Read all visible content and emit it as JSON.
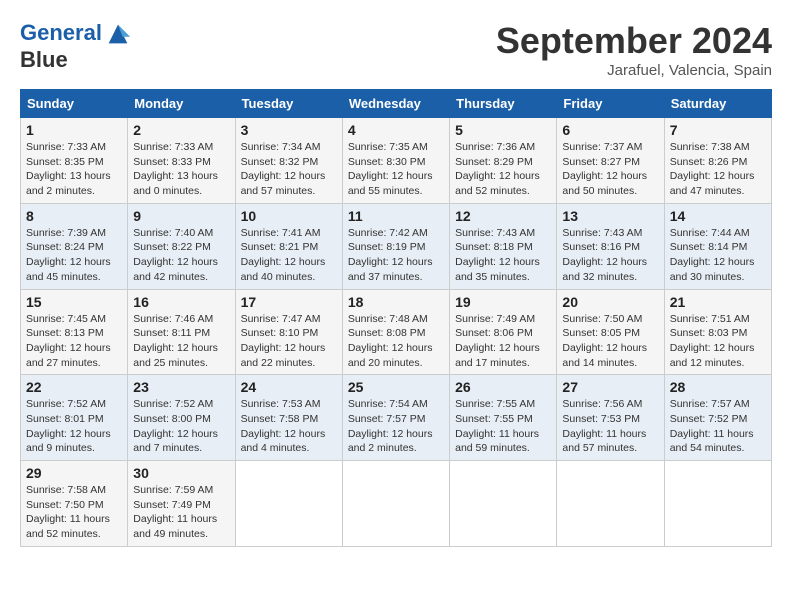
{
  "logo": {
    "line1": "General",
    "line2": "Blue"
  },
  "title": "September 2024",
  "location": "Jarafuel, Valencia, Spain",
  "days_of_week": [
    "Sunday",
    "Monday",
    "Tuesday",
    "Wednesday",
    "Thursday",
    "Friday",
    "Saturday"
  ],
  "weeks": [
    [
      {
        "day": "1",
        "sunrise": "Sunrise: 7:33 AM",
        "sunset": "Sunset: 8:35 PM",
        "daylight": "Daylight: 13 hours and 2 minutes."
      },
      {
        "day": "2",
        "sunrise": "Sunrise: 7:33 AM",
        "sunset": "Sunset: 8:33 PM",
        "daylight": "Daylight: 13 hours and 0 minutes."
      },
      {
        "day": "3",
        "sunrise": "Sunrise: 7:34 AM",
        "sunset": "Sunset: 8:32 PM",
        "daylight": "Daylight: 12 hours and 57 minutes."
      },
      {
        "day": "4",
        "sunrise": "Sunrise: 7:35 AM",
        "sunset": "Sunset: 8:30 PM",
        "daylight": "Daylight: 12 hours and 55 minutes."
      },
      {
        "day": "5",
        "sunrise": "Sunrise: 7:36 AM",
        "sunset": "Sunset: 8:29 PM",
        "daylight": "Daylight: 12 hours and 52 minutes."
      },
      {
        "day": "6",
        "sunrise": "Sunrise: 7:37 AM",
        "sunset": "Sunset: 8:27 PM",
        "daylight": "Daylight: 12 hours and 50 minutes."
      },
      {
        "day": "7",
        "sunrise": "Sunrise: 7:38 AM",
        "sunset": "Sunset: 8:26 PM",
        "daylight": "Daylight: 12 hours and 47 minutes."
      }
    ],
    [
      {
        "day": "8",
        "sunrise": "Sunrise: 7:39 AM",
        "sunset": "Sunset: 8:24 PM",
        "daylight": "Daylight: 12 hours and 45 minutes."
      },
      {
        "day": "9",
        "sunrise": "Sunrise: 7:40 AM",
        "sunset": "Sunset: 8:22 PM",
        "daylight": "Daylight: 12 hours and 42 minutes."
      },
      {
        "day": "10",
        "sunrise": "Sunrise: 7:41 AM",
        "sunset": "Sunset: 8:21 PM",
        "daylight": "Daylight: 12 hours and 40 minutes."
      },
      {
        "day": "11",
        "sunrise": "Sunrise: 7:42 AM",
        "sunset": "Sunset: 8:19 PM",
        "daylight": "Daylight: 12 hours and 37 minutes."
      },
      {
        "day": "12",
        "sunrise": "Sunrise: 7:43 AM",
        "sunset": "Sunset: 8:18 PM",
        "daylight": "Daylight: 12 hours and 35 minutes."
      },
      {
        "day": "13",
        "sunrise": "Sunrise: 7:43 AM",
        "sunset": "Sunset: 8:16 PM",
        "daylight": "Daylight: 12 hours and 32 minutes."
      },
      {
        "day": "14",
        "sunrise": "Sunrise: 7:44 AM",
        "sunset": "Sunset: 8:14 PM",
        "daylight": "Daylight: 12 hours and 30 minutes."
      }
    ],
    [
      {
        "day": "15",
        "sunrise": "Sunrise: 7:45 AM",
        "sunset": "Sunset: 8:13 PM",
        "daylight": "Daylight: 12 hours and 27 minutes."
      },
      {
        "day": "16",
        "sunrise": "Sunrise: 7:46 AM",
        "sunset": "Sunset: 8:11 PM",
        "daylight": "Daylight: 12 hours and 25 minutes."
      },
      {
        "day": "17",
        "sunrise": "Sunrise: 7:47 AM",
        "sunset": "Sunset: 8:10 PM",
        "daylight": "Daylight: 12 hours and 22 minutes."
      },
      {
        "day": "18",
        "sunrise": "Sunrise: 7:48 AM",
        "sunset": "Sunset: 8:08 PM",
        "daylight": "Daylight: 12 hours and 20 minutes."
      },
      {
        "day": "19",
        "sunrise": "Sunrise: 7:49 AM",
        "sunset": "Sunset: 8:06 PM",
        "daylight": "Daylight: 12 hours and 17 minutes."
      },
      {
        "day": "20",
        "sunrise": "Sunrise: 7:50 AM",
        "sunset": "Sunset: 8:05 PM",
        "daylight": "Daylight: 12 hours and 14 minutes."
      },
      {
        "day": "21",
        "sunrise": "Sunrise: 7:51 AM",
        "sunset": "Sunset: 8:03 PM",
        "daylight": "Daylight: 12 hours and 12 minutes."
      }
    ],
    [
      {
        "day": "22",
        "sunrise": "Sunrise: 7:52 AM",
        "sunset": "Sunset: 8:01 PM",
        "daylight": "Daylight: 12 hours and 9 minutes."
      },
      {
        "day": "23",
        "sunrise": "Sunrise: 7:52 AM",
        "sunset": "Sunset: 8:00 PM",
        "daylight": "Daylight: 12 hours and 7 minutes."
      },
      {
        "day": "24",
        "sunrise": "Sunrise: 7:53 AM",
        "sunset": "Sunset: 7:58 PM",
        "daylight": "Daylight: 12 hours and 4 minutes."
      },
      {
        "day": "25",
        "sunrise": "Sunrise: 7:54 AM",
        "sunset": "Sunset: 7:57 PM",
        "daylight": "Daylight: 12 hours and 2 minutes."
      },
      {
        "day": "26",
        "sunrise": "Sunrise: 7:55 AM",
        "sunset": "Sunset: 7:55 PM",
        "daylight": "Daylight: 11 hours and 59 minutes."
      },
      {
        "day": "27",
        "sunrise": "Sunrise: 7:56 AM",
        "sunset": "Sunset: 7:53 PM",
        "daylight": "Daylight: 11 hours and 57 minutes."
      },
      {
        "day": "28",
        "sunrise": "Sunrise: 7:57 AM",
        "sunset": "Sunset: 7:52 PM",
        "daylight": "Daylight: 11 hours and 54 minutes."
      }
    ],
    [
      {
        "day": "29",
        "sunrise": "Sunrise: 7:58 AM",
        "sunset": "Sunset: 7:50 PM",
        "daylight": "Daylight: 11 hours and 52 minutes."
      },
      {
        "day": "30",
        "sunrise": "Sunrise: 7:59 AM",
        "sunset": "Sunset: 7:49 PM",
        "daylight": "Daylight: 11 hours and 49 minutes."
      },
      null,
      null,
      null,
      null,
      null
    ]
  ]
}
